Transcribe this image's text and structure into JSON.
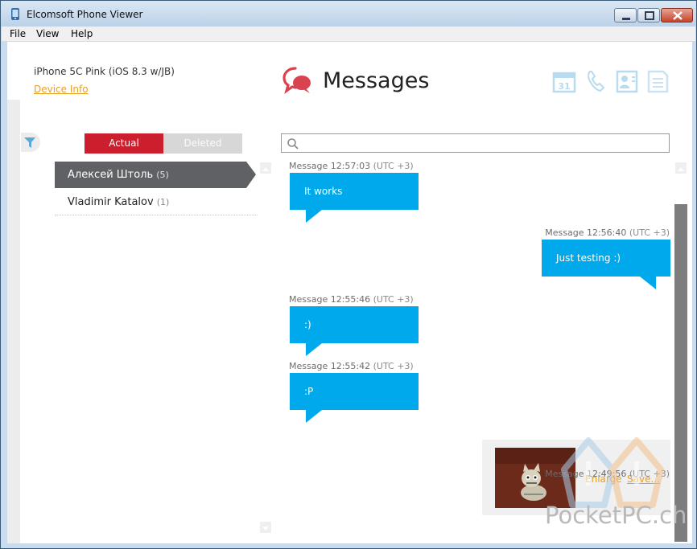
{
  "window": {
    "title": "Elcomsoft Phone Viewer"
  },
  "menu": [
    {
      "label": "File"
    },
    {
      "label": "View"
    },
    {
      "label": "Help"
    }
  ],
  "device": {
    "name": "iPhone 5C Pink (iOS 8.3 w/JB)",
    "info_link": "Device Info"
  },
  "header": {
    "title": "Messages"
  },
  "nav_icons": [
    "calendar-icon",
    "phone-icon",
    "contacts-icon",
    "notes-icon"
  ],
  "filter": {
    "actual": "Actual",
    "deleted": "Deleted"
  },
  "contacts": [
    {
      "name": "Алексей Штоль",
      "count": "(5)"
    },
    {
      "name": "Vladimir Katalov",
      "count": "(1)"
    }
  ],
  "search": {
    "placeholder": ""
  },
  "messages": [
    {
      "time": "Message 12:57:03",
      "tz": "(UTC +3)",
      "text": "It works",
      "direction": "incoming"
    },
    {
      "time": "Message 12:56:40",
      "tz": "(UTC +3)",
      "text": "Just testing :)",
      "direction": "outgoing"
    },
    {
      "time": "Message 12:55:46",
      "tz": "(UTC +3)",
      "text": ":)",
      "direction": "incoming"
    },
    {
      "time": "Message 12:55:42",
      "tz": "(UTC +3)",
      "text": ":P",
      "direction": "incoming"
    },
    {
      "time": "Message 12:49:56",
      "tz": "(UTC +3)",
      "attachment": "image",
      "enlarge": "Enlarge",
      "save": "Save..."
    }
  ],
  "watermark": "PocketPC.ch",
  "colors": {
    "accent": "#cc1f2d",
    "bubble": "#00a9ec",
    "link": "#e8a021",
    "selected": "#5f6165"
  }
}
